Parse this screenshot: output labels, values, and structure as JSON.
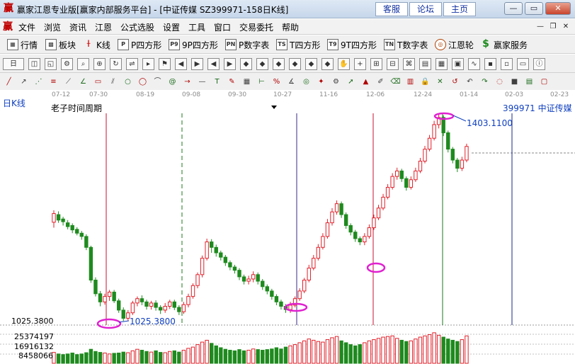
{
  "window": {
    "title": "赢家江恩专业版[赢家内部服务平台] - [中证传媒  SZ399971-158日K线]",
    "links": [
      "客服",
      "论坛",
      "主页"
    ]
  },
  "menu": {
    "items": [
      "文件",
      "浏览",
      "资讯",
      "江恩",
      "公式选股",
      "设置",
      "工具",
      "窗口",
      "交易委托",
      "帮助"
    ]
  },
  "toolbar1": {
    "items": [
      {
        "label": "行情",
        "icon": "grid-icon"
      },
      {
        "label": "板块",
        "icon": "blocks-icon"
      },
      {
        "label": "K线",
        "icon": "candlestick-icon"
      },
      {
        "label": "P四方形",
        "icon": "P"
      },
      {
        "label": "9P四方形",
        "icon": "P9"
      },
      {
        "label": "P数字表",
        "icon": "PN"
      },
      {
        "label": "T四方形",
        "icon": "TS"
      },
      {
        "label": "9T四方形",
        "icon": "T9"
      },
      {
        "label": "T数字表",
        "icon": "TN"
      },
      {
        "label": "江恩轮",
        "icon": "wheel-icon"
      },
      {
        "label": "赢家服务",
        "icon": "dollar-icon"
      }
    ]
  },
  "chart": {
    "kline_label": "日K线",
    "period_label": "老子时间周期",
    "code_label": "399971  中证传媒",
    "high_label": "1403.1100",
    "low_label": "1025.3800",
    "left_price": "1025.3800",
    "volume_labels": [
      "25374197",
      "16916132",
      "8458066"
    ],
    "dates": [
      "07-12",
      "07-30",
      "08-19",
      "09-08",
      "09-30",
      "10-27",
      "11-16",
      "12-06",
      "12-24",
      "01-14",
      "02-03",
      "02-23"
    ]
  },
  "chart_data": {
    "type": "candlestick",
    "title": "中证传媒 SZ399971 日K线",
    "y_high": 1403.11,
    "y_low": 1025.38,
    "candles": [
      [
        1.0,
        1206,
        1222,
        1196,
        1228
      ],
      [
        1.0,
        1220,
        1210,
        1205,
        1226
      ],
      [
        1.0,
        1212,
        1207,
        1200,
        1216
      ],
      [
        1.0,
        1205,
        1198,
        1193,
        1210
      ],
      [
        1.0,
        1200,
        1192,
        1186,
        1204
      ],
      [
        1.0,
        1193,
        1186,
        1182,
        1197
      ],
      [
        1.0,
        1186,
        1180,
        1174,
        1190
      ],
      [
        1.0,
        1180,
        1160,
        1155,
        1184
      ],
      [
        1.0,
        1160,
        1100,
        1095,
        1163
      ],
      [
        1.0,
        1100,
        1075,
        1070,
        1105
      ],
      [
        1.0,
        1075,
        1060,
        1052,
        1080
      ],
      [
        1.0,
        1060,
        1070,
        1055,
        1075
      ],
      [
        1.0,
        1070,
        1078,
        1062,
        1082
      ],
      [
        1.0,
        1078,
        1062,
        1058,
        1082
      ],
      [
        1.0,
        1062,
        1045,
        1040,
        1066
      ],
      [
        1.0,
        1045,
        1030,
        1025,
        1050
      ],
      [
        1.0,
        1030,
        1040,
        1026,
        1045
      ],
      [
        1.0,
        1040,
        1058,
        1036,
        1062
      ],
      [
        1.0,
        1058,
        1066,
        1052,
        1070
      ],
      [
        1.0,
        1066,
        1060,
        1054,
        1072
      ],
      [
        1.0,
        1060,
        1052,
        1046,
        1064
      ],
      [
        1.0,
        1052,
        1058,
        1046,
        1062
      ],
      [
        1.0,
        1058,
        1050,
        1044,
        1063
      ],
      [
        1.0,
        1050,
        1045,
        1038,
        1054
      ],
      [
        1.0,
        1045,
        1052,
        1040,
        1058
      ],
      [
        1.0,
        1052,
        1060,
        1047,
        1064
      ],
      [
        1.0,
        1060,
        1050,
        1045,
        1064
      ],
      [
        1.0,
        1050,
        1042,
        1036,
        1054
      ],
      [
        1.0,
        1042,
        1055,
        1038,
        1060
      ],
      [
        1.0,
        1055,
        1070,
        1050,
        1075
      ],
      [
        1.0,
        1070,
        1090,
        1066,
        1094
      ],
      [
        1.0,
        1090,
        1110,
        1085,
        1114
      ],
      [
        1.0,
        1110,
        1140,
        1105,
        1145
      ],
      [
        1.0,
        1140,
        1170,
        1136,
        1176
      ],
      [
        1.0,
        1170,
        1160,
        1150,
        1175
      ],
      [
        1.0,
        1160,
        1150,
        1143,
        1165
      ],
      [
        1.0,
        1150,
        1142,
        1136,
        1154
      ],
      [
        1.0,
        1142,
        1132,
        1126,
        1146
      ],
      [
        1.0,
        1132,
        1124,
        1118,
        1136
      ],
      [
        1.0,
        1124,
        1118,
        1112,
        1128
      ],
      [
        1.0,
        1118,
        1106,
        1100,
        1122
      ],
      [
        1.0,
        1106,
        1098,
        1092,
        1110
      ],
      [
        1.0,
        1098,
        1102,
        1092,
        1108
      ],
      [
        1.0,
        1102,
        1110,
        1096,
        1116
      ],
      [
        1.0,
        1110,
        1098,
        1092,
        1114
      ],
      [
        1.0,
        1098,
        1088,
        1082,
        1102
      ],
      [
        1.0,
        1088,
        1080,
        1074,
        1092
      ],
      [
        1.0,
        1080,
        1070,
        1064,
        1084
      ],
      [
        1.0,
        1070,
        1060,
        1054,
        1074
      ],
      [
        1.0,
        1060,
        1052,
        1046,
        1064
      ],
      [
        1.0,
        1052,
        1046,
        1040,
        1056
      ],
      [
        1.0,
        1046,
        1054,
        1040,
        1060
      ],
      [
        1.0,
        1054,
        1066,
        1050,
        1070
      ],
      [
        1.0,
        1066,
        1080,
        1062,
        1085
      ],
      [
        1.0,
        1080,
        1100,
        1076,
        1104
      ],
      [
        1.0,
        1100,
        1122,
        1096,
        1128
      ],
      [
        1.0,
        1122,
        1140,
        1118,
        1146
      ],
      [
        1.0,
        1140,
        1160,
        1136,
        1166
      ],
      [
        1.0,
        1160,
        1180,
        1156,
        1186
      ],
      [
        1.0,
        1180,
        1205,
        1176,
        1212
      ],
      [
        1.0,
        1205,
        1225,
        1200,
        1232
      ],
      [
        1.0,
        1225,
        1240,
        1220,
        1246
      ],
      [
        1.0,
        1240,
        1220,
        1214,
        1244
      ],
      [
        1.0,
        1220,
        1200,
        1194,
        1224
      ],
      [
        1.0,
        1200,
        1188,
        1182,
        1204
      ],
      [
        1.0,
        1188,
        1176,
        1170,
        1192
      ],
      [
        1.0,
        1176,
        1170,
        1164,
        1180
      ],
      [
        1.0,
        1170,
        1180,
        1164,
        1186
      ],
      [
        1.0,
        1180,
        1196,
        1176,
        1202
      ],
      [
        1.0,
        1196,
        1214,
        1192,
        1220
      ],
      [
        1.0,
        1214,
        1232,
        1210,
        1238
      ],
      [
        1.0,
        1232,
        1252,
        1228,
        1258
      ],
      [
        1.0,
        1252,
        1270,
        1248,
        1276
      ],
      [
        1.0,
        1270,
        1290,
        1266,
        1296
      ],
      [
        1.0,
        1290,
        1300,
        1284,
        1306
      ],
      [
        1.0,
        1300,
        1286,
        1280,
        1304
      ],
      [
        1.0,
        1286,
        1270,
        1264,
        1290
      ],
      [
        1.0,
        1270,
        1284,
        1266,
        1290
      ],
      [
        1.0,
        1284,
        1300,
        1280,
        1306
      ],
      [
        1.0,
        1300,
        1318,
        1296,
        1324
      ],
      [
        1.0,
        1318,
        1340,
        1314,
        1346
      ],
      [
        1.0,
        1340,
        1360,
        1336,
        1366
      ],
      [
        1.0,
        1360,
        1385,
        1356,
        1392
      ],
      [
        1.0,
        1385,
        1398,
        1378,
        1403.11
      ],
      [
        1.0,
        1398,
        1370,
        1364,
        1402
      ],
      [
        1.0,
        1370,
        1340,
        1334,
        1374
      ],
      [
        1.0,
        1340,
        1320,
        1314,
        1344
      ],
      [
        1.0,
        1320,
        1305,
        1298,
        1324
      ],
      [
        1.0,
        1305,
        1320,
        1300,
        1326
      ],
      [
        1.0,
        1320,
        1345,
        1316,
        1350
      ]
    ],
    "volumes": [
      0.35,
      0.3,
      0.28,
      0.3,
      0.33,
      0.28,
      0.3,
      0.34,
      0.45,
      0.38,
      0.35,
      0.33,
      0.3,
      0.32,
      0.33,
      0.36,
      0.34,
      0.4,
      0.45,
      0.42,
      0.38,
      0.36,
      0.4,
      0.35,
      0.34,
      0.38,
      0.4,
      0.36,
      0.42,
      0.48,
      0.52,
      0.6,
      0.68,
      0.74,
      0.64,
      0.56,
      0.5,
      0.45,
      0.42,
      0.4,
      0.44,
      0.4,
      0.42,
      0.46,
      0.44,
      0.42,
      0.44,
      0.46,
      0.5,
      0.46,
      0.52,
      0.56,
      0.6,
      0.66,
      0.72,
      0.78,
      0.74,
      0.7,
      0.68,
      0.76,
      0.82,
      0.86,
      0.72,
      0.66,
      0.6,
      0.56,
      0.6,
      0.66,
      0.72,
      0.76,
      0.8,
      0.84,
      0.86,
      0.88,
      0.8,
      0.74,
      0.7,
      0.72,
      0.78,
      0.84,
      0.88,
      0.92,
      0.98,
      0.9,
      0.84,
      0.78,
      0.74,
      0.7,
      0.76,
      0.88
    ],
    "y_axis_volume": [
      "25374197",
      "16916132",
      "8458066"
    ]
  }
}
